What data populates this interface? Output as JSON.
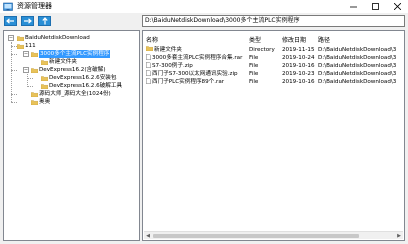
{
  "window": {
    "title": "资源管理器"
  },
  "toolbar": {
    "back_icon": "arrow-left-icon",
    "forward_icon": "arrow-right-icon",
    "up_icon": "arrow-up-icon",
    "path": "D:\\BaiduNetdiskDownload\\3000多个主流PLC实例程序"
  },
  "tree": {
    "root": "BaiduNetdiskDownload",
    "items": [
      "111",
      "3000多个主流PLC实例程序",
      "新建文件夹",
      "DevExpress16.2(含破解)",
      "DevExpress16.2.6安装包",
      "DevExpress16.2.6破解工具",
      "源码大师_源码大全(1024份)",
      "奥奥"
    ]
  },
  "list": {
    "columns": [
      "名称",
      "类型",
      "修改日期",
      "路径"
    ],
    "rows": [
      {
        "name": "新建文件夹",
        "type": "Directory",
        "date": "2019-11-15",
        "path": "D:\\BaiduNetdiskDownload\\3"
      },
      {
        "name": "3000多套主流PLC实例程序合集.rar",
        "type": "File",
        "date": "2019-10-24",
        "path": "D:\\BaiduNetdiskDownload\\3"
      },
      {
        "name": "S7-300例子.zip",
        "type": "File",
        "date": "2019-10-16",
        "path": "D:\\BaiduNetdiskDownload\\3"
      },
      {
        "name": "西门子S7-300以太网通讯实验.zip",
        "type": "File",
        "date": "2019-10-23",
        "path": "D:\\BaiduNetdiskDownload\\3"
      },
      {
        "name": "西门子PLC实例程序89个.rar",
        "type": "File",
        "date": "2019-10-16",
        "path": "D:\\BaiduNetdiskDownload\\3"
      }
    ]
  },
  "colors": {
    "selection": "#3399ff",
    "toolbar_button": "#2a8fd6",
    "folder": "#e8c25a"
  }
}
